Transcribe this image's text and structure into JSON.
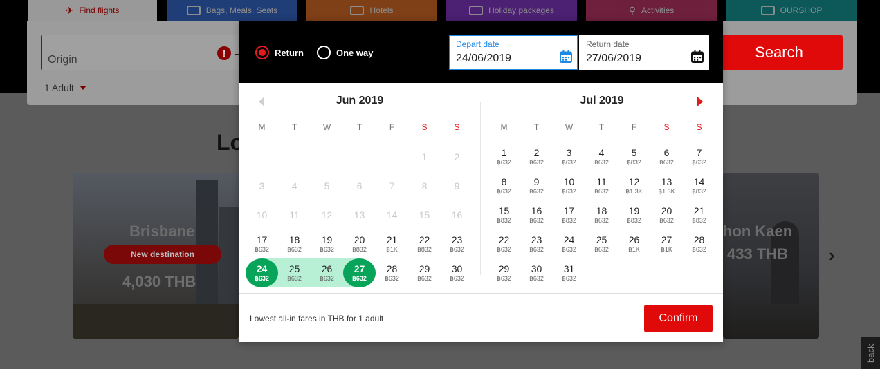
{
  "nav": {
    "tabs": [
      {
        "label": "Find flights",
        "icon": "plane-icon"
      },
      {
        "label": "Bags, Meals, Seats",
        "icon": "suitcase-icon"
      },
      {
        "label": "Hotels",
        "icon": "bed-icon"
      },
      {
        "label": "Holiday packages",
        "icon": "holiday-icon"
      },
      {
        "label": "Activities",
        "icon": "bicycle-icon"
      },
      {
        "label": "OURSHOP",
        "icon": "bag-icon"
      }
    ]
  },
  "search": {
    "origin_placeholder": "Origin",
    "error_mark": "!",
    "passengers": "1 Adult",
    "search_label": "Search"
  },
  "background": {
    "heading_fragment": "Lo",
    "left_tile": {
      "city": "Brisbane",
      "badge": "New destination",
      "price": "4,030 THB"
    },
    "right_tile": {
      "city": "hon Kaen",
      "price": "433 THB"
    },
    "feedback": "back"
  },
  "modal": {
    "trip_types": {
      "return": "Return",
      "one_way": "One way",
      "selected": "return"
    },
    "depart": {
      "label": "Depart date",
      "value": "24/06/2019"
    },
    "return": {
      "label": "Return date",
      "value": "27/06/2019"
    },
    "footer_note": "Lowest all-in fares in THB for 1 adult",
    "confirm_label": "Confirm"
  },
  "calendar": {
    "weekdays": [
      "M",
      "T",
      "W",
      "T",
      "F",
      "S",
      "S"
    ],
    "months": [
      {
        "title": "Jun 2019",
        "lead_blanks": 5,
        "days": [
          {
            "d": "1",
            "p": "",
            "past": true
          },
          {
            "d": "2",
            "p": "",
            "past": true
          },
          {
            "d": "3",
            "p": "",
            "past": true
          },
          {
            "d": "4",
            "p": "",
            "past": true
          },
          {
            "d": "5",
            "p": "",
            "past": true
          },
          {
            "d": "6",
            "p": "",
            "past": true
          },
          {
            "d": "7",
            "p": "",
            "past": true
          },
          {
            "d": "8",
            "p": "",
            "past": true
          },
          {
            "d": "9",
            "p": "",
            "past": true
          },
          {
            "d": "10",
            "p": "",
            "past": true
          },
          {
            "d": "11",
            "p": "",
            "past": true
          },
          {
            "d": "12",
            "p": "",
            "past": true
          },
          {
            "d": "13",
            "p": "",
            "past": true
          },
          {
            "d": "14",
            "p": "",
            "past": true
          },
          {
            "d": "15",
            "p": "",
            "past": true
          },
          {
            "d": "16",
            "p": "",
            "past": true
          },
          {
            "d": "17",
            "p": "฿632"
          },
          {
            "d": "18",
            "p": "฿632"
          },
          {
            "d": "19",
            "p": "฿632"
          },
          {
            "d": "20",
            "p": "฿832"
          },
          {
            "d": "21",
            "p": "฿1K"
          },
          {
            "d": "22",
            "p": "฿832"
          },
          {
            "d": "23",
            "p": "฿632"
          },
          {
            "d": "24",
            "p": "฿632",
            "sel": "start"
          },
          {
            "d": "25",
            "p": "฿632",
            "range": true
          },
          {
            "d": "26",
            "p": "฿632",
            "range": true
          },
          {
            "d": "27",
            "p": "฿632",
            "sel": "end"
          },
          {
            "d": "28",
            "p": "฿632"
          },
          {
            "d": "29",
            "p": "฿632"
          },
          {
            "d": "30",
            "p": "฿632"
          }
        ]
      },
      {
        "title": "Jul 2019",
        "lead_blanks": 0,
        "days": [
          {
            "d": "1",
            "p": "฿632"
          },
          {
            "d": "2",
            "p": "฿632"
          },
          {
            "d": "3",
            "p": "฿632"
          },
          {
            "d": "4",
            "p": "฿632"
          },
          {
            "d": "5",
            "p": "฿832"
          },
          {
            "d": "6",
            "p": "฿632"
          },
          {
            "d": "7",
            "p": "฿632"
          },
          {
            "d": "8",
            "p": "฿632"
          },
          {
            "d": "9",
            "p": "฿632"
          },
          {
            "d": "10",
            "p": "฿632"
          },
          {
            "d": "11",
            "p": "฿632"
          },
          {
            "d": "12",
            "p": "฿1.3K"
          },
          {
            "d": "13",
            "p": "฿1.3K"
          },
          {
            "d": "14",
            "p": "฿832"
          },
          {
            "d": "15",
            "p": "฿832"
          },
          {
            "d": "16",
            "p": "฿632"
          },
          {
            "d": "17",
            "p": "฿832"
          },
          {
            "d": "18",
            "p": "฿632"
          },
          {
            "d": "19",
            "p": "฿832"
          },
          {
            "d": "20",
            "p": "฿632"
          },
          {
            "d": "21",
            "p": "฿832"
          },
          {
            "d": "22",
            "p": "฿632"
          },
          {
            "d": "23",
            "p": "฿632"
          },
          {
            "d": "24",
            "p": "฿632"
          },
          {
            "d": "25",
            "p": "฿632"
          },
          {
            "d": "26",
            "p": "฿1K"
          },
          {
            "d": "27",
            "p": "฿1K"
          },
          {
            "d": "28",
            "p": "฿632"
          },
          {
            "d": "29",
            "p": "฿632"
          },
          {
            "d": "30",
            "p": "฿632"
          },
          {
            "d": "31",
            "p": "฿632"
          }
        ]
      }
    ]
  },
  "colors": {
    "accent": "#e31b1b",
    "selected": "#08a45a",
    "range": "#b7f0d4",
    "focus": "#1e88e5"
  }
}
